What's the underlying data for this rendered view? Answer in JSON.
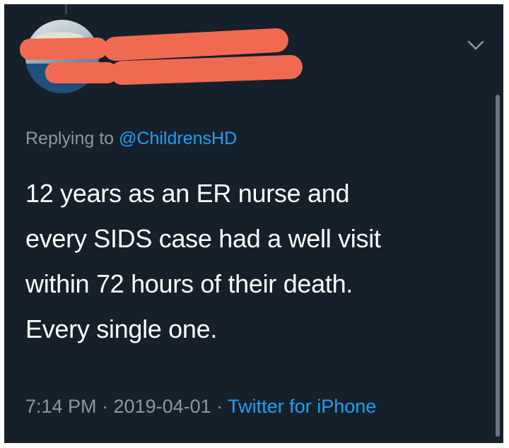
{
  "tweet": {
    "author_display_name": "[redacted]",
    "author_handle": "[redacted]",
    "reply": {
      "prefix": "Replying to",
      "handle": "@ChildrensHD"
    },
    "body_lines": [
      "12 years as an ER nurse and",
      "every SIDS case  had a well visit",
      "within 72 hours of their death.",
      "Every single one."
    ],
    "timestamp": "7:14 PM · 2019-04-01 · ",
    "source": "Twitter for iPhone",
    "icons": [
      "avatar",
      "chevron-down-icon"
    ],
    "colors": {
      "background": "#15202b",
      "text": "#ffffff",
      "secondary_text": "#8899a6",
      "link": "#1da1f2",
      "redaction": "#f06a52"
    }
  }
}
